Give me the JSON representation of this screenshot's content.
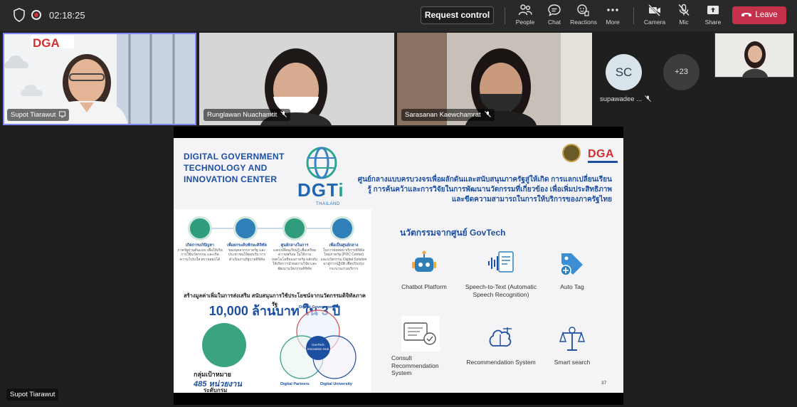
{
  "toolbar": {
    "timer": "02:18:25",
    "request_control": "Request control",
    "people": "People",
    "chat": "Chat",
    "reactions": "Reactions",
    "more": "More",
    "camera": "Camera",
    "mic": "Mic",
    "share": "Share",
    "leave": "Leave"
  },
  "participants": [
    {
      "name": "Supot Tiarawut"
    },
    {
      "name": "Runglawan Nuachamtit"
    },
    {
      "name": "Sarasanan Kaewchamrat"
    },
    {
      "name": "supawadee ...",
      "initials": "SC"
    }
  ],
  "overflow_count": "+23",
  "presenter": "Supot Tiarawut",
  "slide": {
    "title": "DIGITAL GOVERNMENT TECHNOLOGY AND INNOVATION CENTER",
    "logo_word": "DGT",
    "logo_i": "i",
    "logo_sub": "THAILAND",
    "dga": "DGA",
    "thai_heading": "ศูนย์กลางแบบครบวงจรเพื่อผลักดันและสนับสนุนภาครัฐสู่ให้เกิด การแลกเปลี่ยนเรียนรู้ การค้นคว้าและการวิจัยในการพัฒนานวัตกรรมที่เกี่ยวข้อง เพื่อเพิ่มประสิทธิภาพและขีดความสามารถในการให้บริการของภาครัฐไทย",
    "goals": [
      {
        "head": "เกิดการแก้ปัญหา",
        "body": "ภาครัฐผ่านต้นแบบ เพื่อให้เกิดการใช้นวัตกรรม และเกิดความโปร่งใส ตรวจสอบได้"
      },
      {
        "head": "เพื่อยกระดับทักษะดิจิทัล",
        "body": "ของบุคลากรภาครัฐ และประชาชนให้ตอบรับ การดำเนินงานรัฐบาลดิจิทัล"
      },
      {
        "head": "ศูนย์กลางในการ",
        "body": "แลกเปลี่ยนเรียนรู้ เพื่อเตรียมความพร้อม ในใช้งานเทคโนโลยีของภาครัฐ ผลักดัน ให้เกิดการนำผลงานวิจัย และพัฒนานวัตกรรมดิจิทัล"
      },
      {
        "head": "เพื่อเป็นศูนย์กลาง",
        "body": "ในการทดสอบ บริการดิจิทัลใหม่ภาครัฐ (POC Center) และนวัตกรรม Digital Solution มาสู่การปฏิบัติ เพื่อปรับปรุงกระบวนงานบริการ"
      }
    ],
    "value_line": "สร้างมูลค่าเพิ่มในการส่งเสริม สนับสนุนการใช้ประโยชน์จากนวัตกรรมดิจิทัลภาครัฐ",
    "value_big": "10,000 ล้านบาท ใน 3 ปี",
    "target_label": "กลุ่มเป้าหมาย",
    "target_count": "485 หน่วยงาน",
    "target_unit": "ระดับกรม",
    "venn": {
      "top": "Digital Government",
      "center": "GovTech Innovation Hub",
      "left": "Digital Partners",
      "right": "Digital University"
    },
    "innovations_title": "นวัตกรรมจากศูนย์ GovTech",
    "features": [
      "Chatbot Platform",
      "Speech-to-Text (Automatic Speech Recognition)",
      "Auto Tag",
      "Consult Recommendation System",
      "Recommendation System",
      "Smart search"
    ],
    "page_number": "37"
  }
}
